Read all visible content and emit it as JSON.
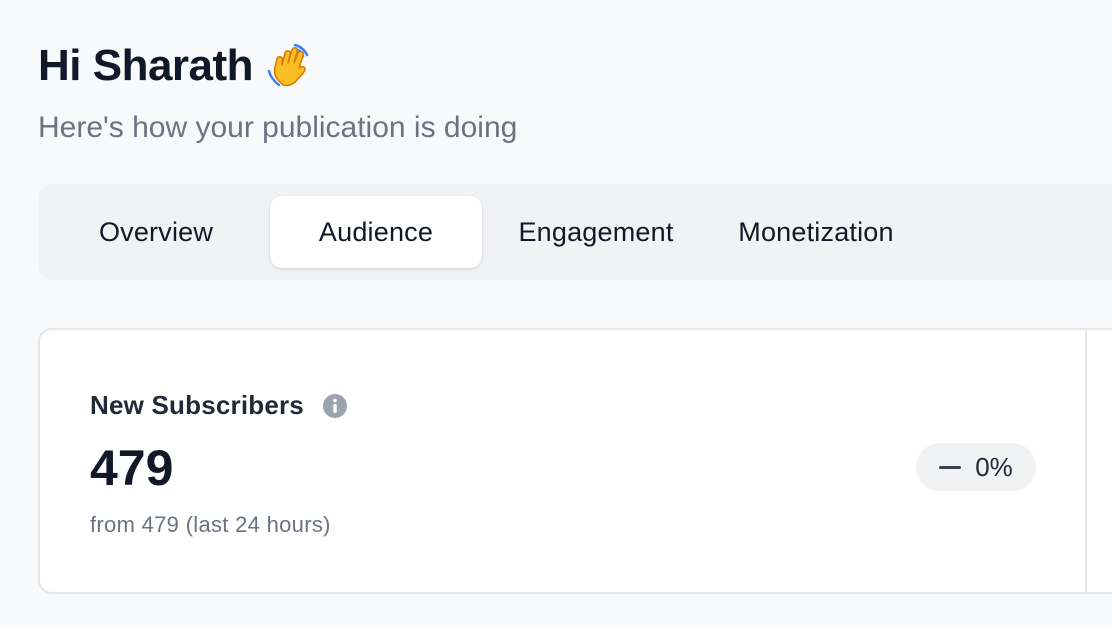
{
  "header": {
    "greeting": "Hi Sharath",
    "wave_icon": "waving-hand-icon",
    "subtitle": "Here's how your publication is doing"
  },
  "tabs": [
    {
      "label": "Overview",
      "active": false
    },
    {
      "label": "Audience",
      "active": true
    },
    {
      "label": "Engagement",
      "active": false
    },
    {
      "label": "Monetization",
      "active": false
    }
  ],
  "metric_card": {
    "label": "New Subscribers",
    "info_icon": "info-icon",
    "value": "479",
    "sub_text": "from 479 (last 24 hours)",
    "change": "0%",
    "change_icon": "dash-icon"
  },
  "colors": {
    "background": "#f8f9fb",
    "tab_bar": "#f1f2f4",
    "active_tab": "#ffffff",
    "text_primary": "#111827",
    "text_secondary": "#6b7280",
    "badge_bg": "#f1f2f4",
    "wave_yellow": "#fbbf24"
  }
}
